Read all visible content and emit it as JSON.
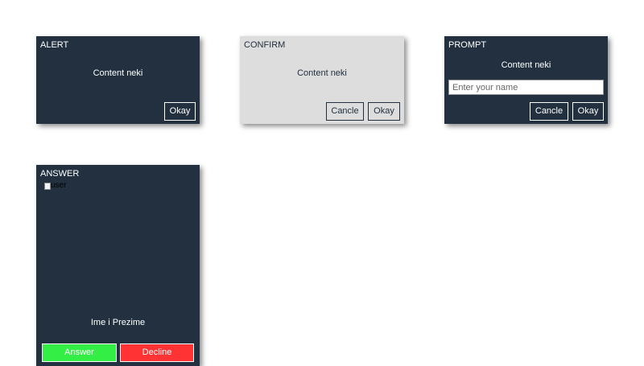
{
  "alert": {
    "title": "ALERT",
    "content": "Content neki",
    "okay_label": "Okay"
  },
  "confirm": {
    "title": "CONFIRM",
    "content": "Content neki",
    "cancel_label": "Cancle",
    "okay_label": "Okay"
  },
  "prompt": {
    "title": "PROMPT",
    "content": "Content neki",
    "input_value": "",
    "input_placeholder": "Enter your name",
    "cancel_label": "Cancle",
    "okay_label": "Okay"
  },
  "answer": {
    "title": "ANSWER",
    "image_alt": "user",
    "caller_name": "Ime i Prezime",
    "answer_label": "Answer",
    "decline_label": "Decline"
  },
  "colors": {
    "dialog_dark": "#223040",
    "dialog_light": "#dddddd",
    "answer_green": "#33ee44",
    "decline_red": "#ff3333"
  },
  "icons": {
    "caller_image": "broken-image-icon"
  }
}
